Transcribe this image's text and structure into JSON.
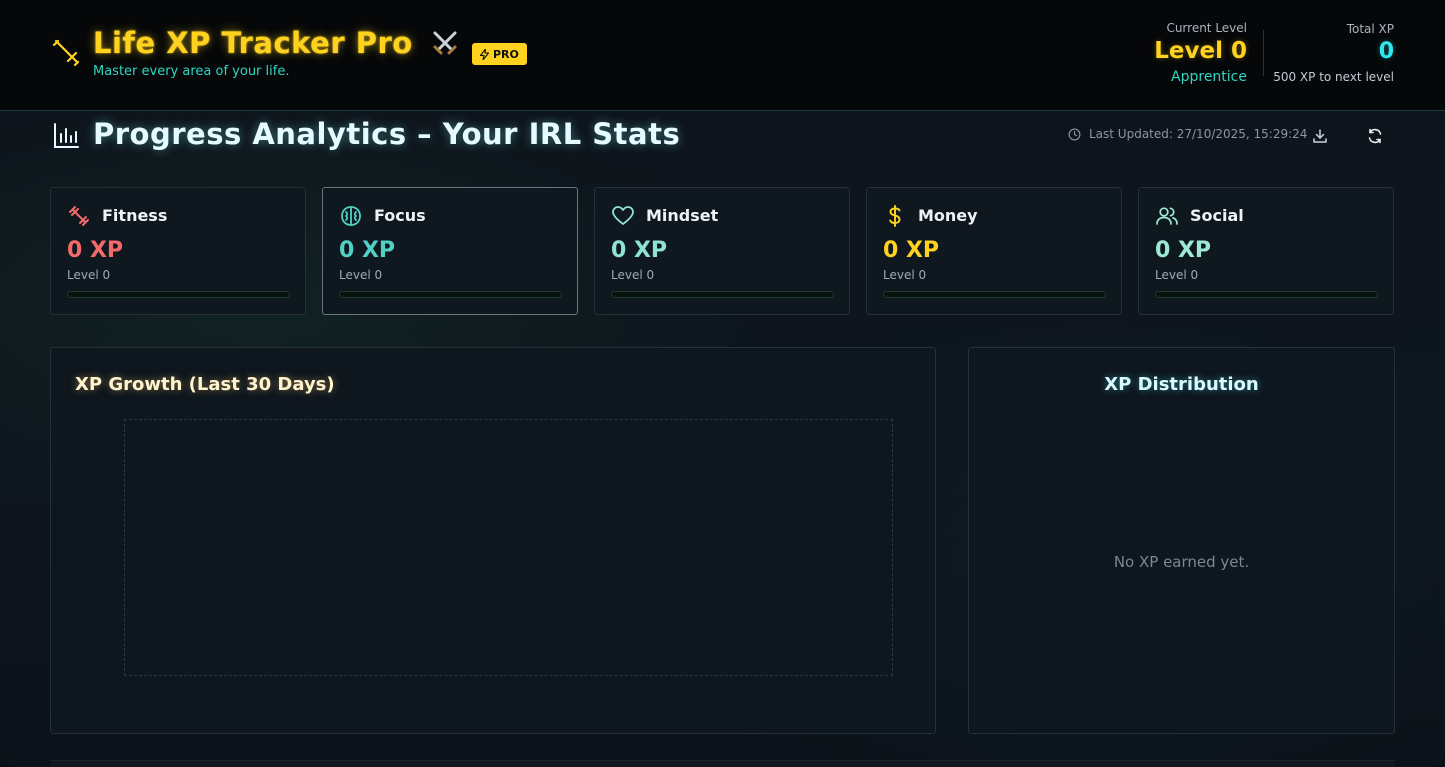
{
  "header": {
    "title": "Life XP Tracker Pro",
    "title_icon": "sword-icon",
    "emoji_icon": "crossed-swords-icon",
    "pro_badge": "PRO",
    "subtitle": "Master every area of your life.",
    "current_level_label": "Current Level",
    "current_level_value": "Level 0",
    "rank": "Apprentice",
    "total_xp_label": "Total XP",
    "total_xp_value": "0",
    "next_level_text": "500 XP to next level"
  },
  "analytics": {
    "title": "Progress Analytics – Your IRL Stats",
    "last_updated": "Last Updated: 27/10/2025, 15:29:24",
    "download_icon": "download-icon",
    "refresh_icon": "refresh-icon"
  },
  "categories": [
    {
      "name": "Fitness",
      "xp": "0 XP",
      "level": "Level 0",
      "progress": 0,
      "color": "#f26a6a",
      "icon": "dumbbell-icon"
    },
    {
      "name": "Focus",
      "xp": "0 XP",
      "level": "Level 0",
      "progress": 0,
      "color": "#4fd1c5",
      "icon": "brain-icon"
    },
    {
      "name": "Mindset",
      "xp": "0 XP",
      "level": "Level 0",
      "progress": 0,
      "color": "#8fe3d4",
      "icon": "heart-icon"
    },
    {
      "name": "Money",
      "xp": "0 XP",
      "level": "Level 0",
      "progress": 0,
      "color": "#ffd21f",
      "icon": "dollar-icon"
    },
    {
      "name": "Social",
      "xp": "0 XP",
      "level": "Level 0",
      "progress": 0,
      "color": "#9ee8d6",
      "icon": "users-icon"
    }
  ],
  "growth_chart": {
    "title": "XP Growth (Last 30 Days)"
  },
  "distribution_chart": {
    "title": "XP Distribution",
    "empty_text": "No XP earned yet."
  },
  "colors": {
    "accent_gold": "#ffd21f",
    "accent_teal": "#2fd6c2",
    "accent_cyan": "#2fe7ee"
  }
}
